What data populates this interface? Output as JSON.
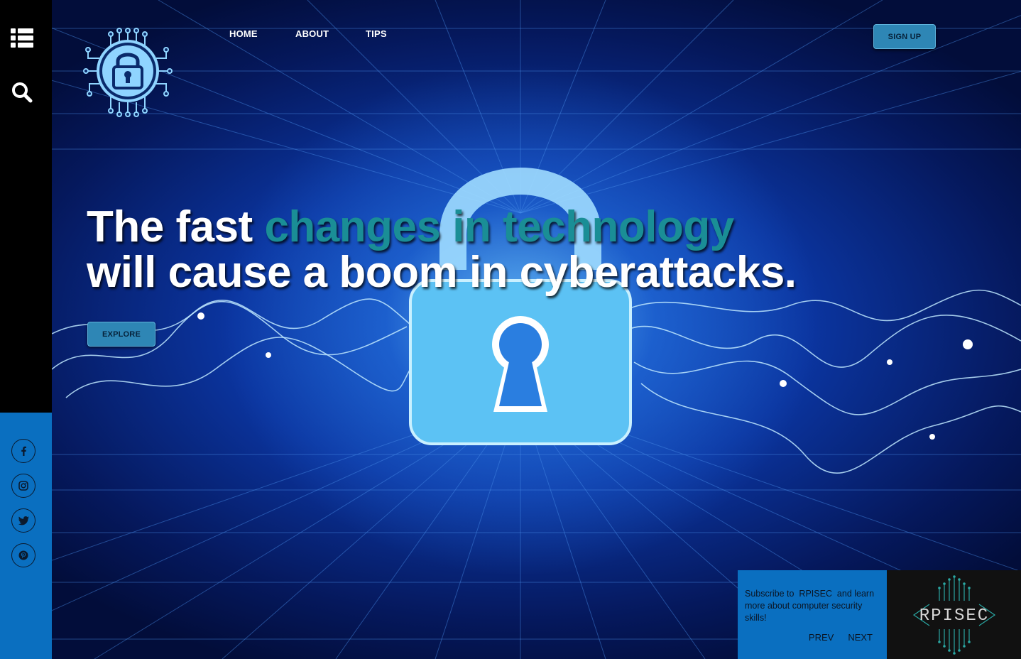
{
  "nav": {
    "home": "HOME",
    "about": "ABOUT",
    "tips": "TIPS"
  },
  "header": {
    "signup_label": "SIGN UP"
  },
  "hero": {
    "line1_plain": "The fast ",
    "line1_accent": "changes in technology",
    "line2": "will cause a boom in cyberattacks.",
    "explore_label": "EXPLORE"
  },
  "sidebar": {
    "menu_icon": "list-icon",
    "search_icon": "search-icon",
    "social": [
      "facebook-icon",
      "instagram-icon",
      "twitter-icon",
      "pinterest-icon"
    ]
  },
  "subscribe": {
    "text": "Subscribe to  RPISEC  and learn more about computer security skills!",
    "prev": "PREV",
    "next": "NEXT",
    "logo_text": "RPISEC"
  },
  "colors": {
    "accent_teal": "#1a8e96",
    "button_blue": "#2e86b5",
    "panel_blue": "#0a6fc0",
    "rail_black": "#000000"
  }
}
